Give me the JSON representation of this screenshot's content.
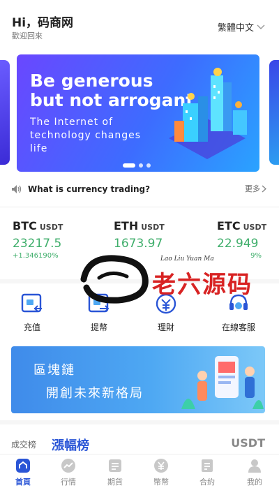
{
  "header": {
    "greeting": "Hi，码商网",
    "welcome": "歡迎回來",
    "language": "繁體中文"
  },
  "banner": {
    "title_line1": "Be generous",
    "title_line2": "but not arrogant",
    "sub_line1": "The Internet of",
    "sub_line2": "technology changes",
    "sub_line3": "life"
  },
  "notice": {
    "text": "What is currency trading?",
    "more": "更多"
  },
  "tickers": [
    {
      "symbol": "BTC",
      "unit": "USDT",
      "price": "23217.5",
      "change": "+1.346190%"
    },
    {
      "symbol": "ETH",
      "unit": "USDT",
      "price": "1673.97",
      "change": ""
    },
    {
      "symbol": "ETC",
      "unit": "USDT",
      "price": "22.949",
      "change": "9%"
    }
  ],
  "quick_actions": [
    {
      "label": "充值",
      "icon": "deposit-icon"
    },
    {
      "label": "提幣",
      "icon": "withdraw-icon"
    },
    {
      "label": "理財",
      "icon": "finance-icon"
    },
    {
      "label": "在線客服",
      "icon": "customer-service-icon"
    }
  ],
  "promo": {
    "line1": "區塊鏈",
    "line2": "開創未來新格局"
  },
  "ranking": {
    "volume_tab": "成交榜",
    "gain_tab": "漲幅榜",
    "unit": "USDT"
  },
  "tabbar": [
    {
      "label": "首頁",
      "icon": "home-icon",
      "active": true
    },
    {
      "label": "行情",
      "icon": "market-icon",
      "active": false
    },
    {
      "label": "期貨",
      "icon": "futures-icon",
      "active": false
    },
    {
      "label": "幣幣",
      "icon": "coin-icon",
      "active": false
    },
    {
      "label": "合約",
      "icon": "contract-icon",
      "active": false
    },
    {
      "label": "我的",
      "icon": "user-icon",
      "active": false
    }
  ],
  "watermark": {
    "latin": "Lao Liu Yuan Ma",
    "text": "老六源码"
  },
  "colors": {
    "accent": "#2a55d6",
    "up": "#3fae6b",
    "banner_start": "#6a47ff",
    "banner_end": "#2aa3ff"
  }
}
